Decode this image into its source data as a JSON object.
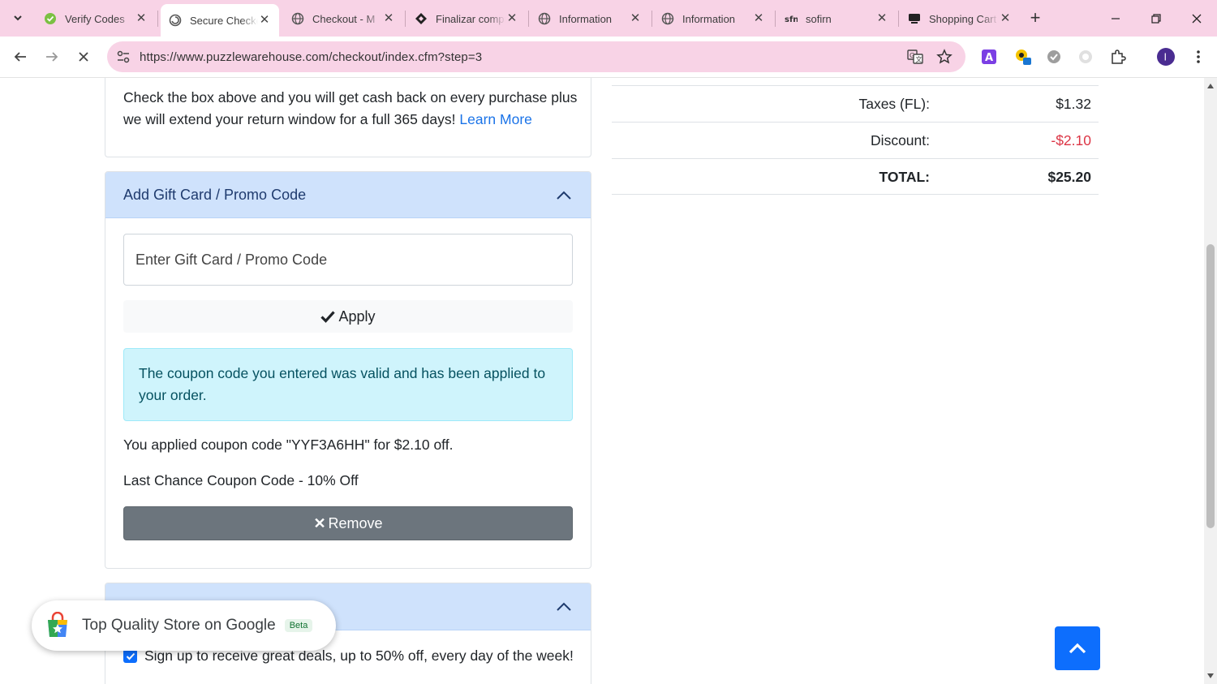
{
  "browser": {
    "tabs": [
      {
        "title": "Verify Codes",
        "favicon": "check-leaf-icon"
      },
      {
        "title": "Secure Checkout",
        "favicon": "spiral-icon",
        "active": true
      },
      {
        "title": "Checkout - M",
        "favicon": "globe-icon"
      },
      {
        "title": "Finalizar compra",
        "favicon": "diamond-logo-icon"
      },
      {
        "title": "Information",
        "favicon": "globe-icon"
      },
      {
        "title": "Information",
        "favicon": "globe-icon"
      },
      {
        "title": "sofirn",
        "favicon": "sofirn-logo-icon"
      },
      {
        "title": "Shopping Cart",
        "favicon": "cart-icon"
      }
    ],
    "url": "https://www.puzzlewarehouse.com/checkout/index.cfm?step=3"
  },
  "cashback": {
    "text": "Check the box above and you will get cash back on every purchase plus we will extend your return window for a full 365 days!",
    "link": "Learn More"
  },
  "promo": {
    "header": "Add Gift Card / Promo Code",
    "placeholder": "Enter Gift Card / Promo Code",
    "apply_label": "Apply",
    "alert": "The coupon code you entered was valid and has been applied to your order.",
    "applied": "You applied coupon code \"YYF3A6HH\" for $2.10 off.",
    "coupon_name": "Last Chance Coupon Code - 10% Off",
    "remove_label": "Remove"
  },
  "newsletter": {
    "signup": "Sign up to receive great deals, up to 50% off, every day of the week!",
    "checked": true
  },
  "summary": {
    "rows": [
      {
        "label": "Taxes (FL):",
        "value": "$1.32"
      },
      {
        "label": "Discount:",
        "value": "-$2.10"
      },
      {
        "label": "TOTAL:",
        "value": "$25.20"
      }
    ]
  },
  "google_badge": {
    "text": "Top Quality Store on Google",
    "beta": "Beta"
  },
  "colors": {
    "accent": "#0d6efd",
    "tab_bar": "#f8d3e6",
    "discount": "#dc3545",
    "alert_bg": "#cff4fc",
    "card_header": "#cfe2fc"
  }
}
